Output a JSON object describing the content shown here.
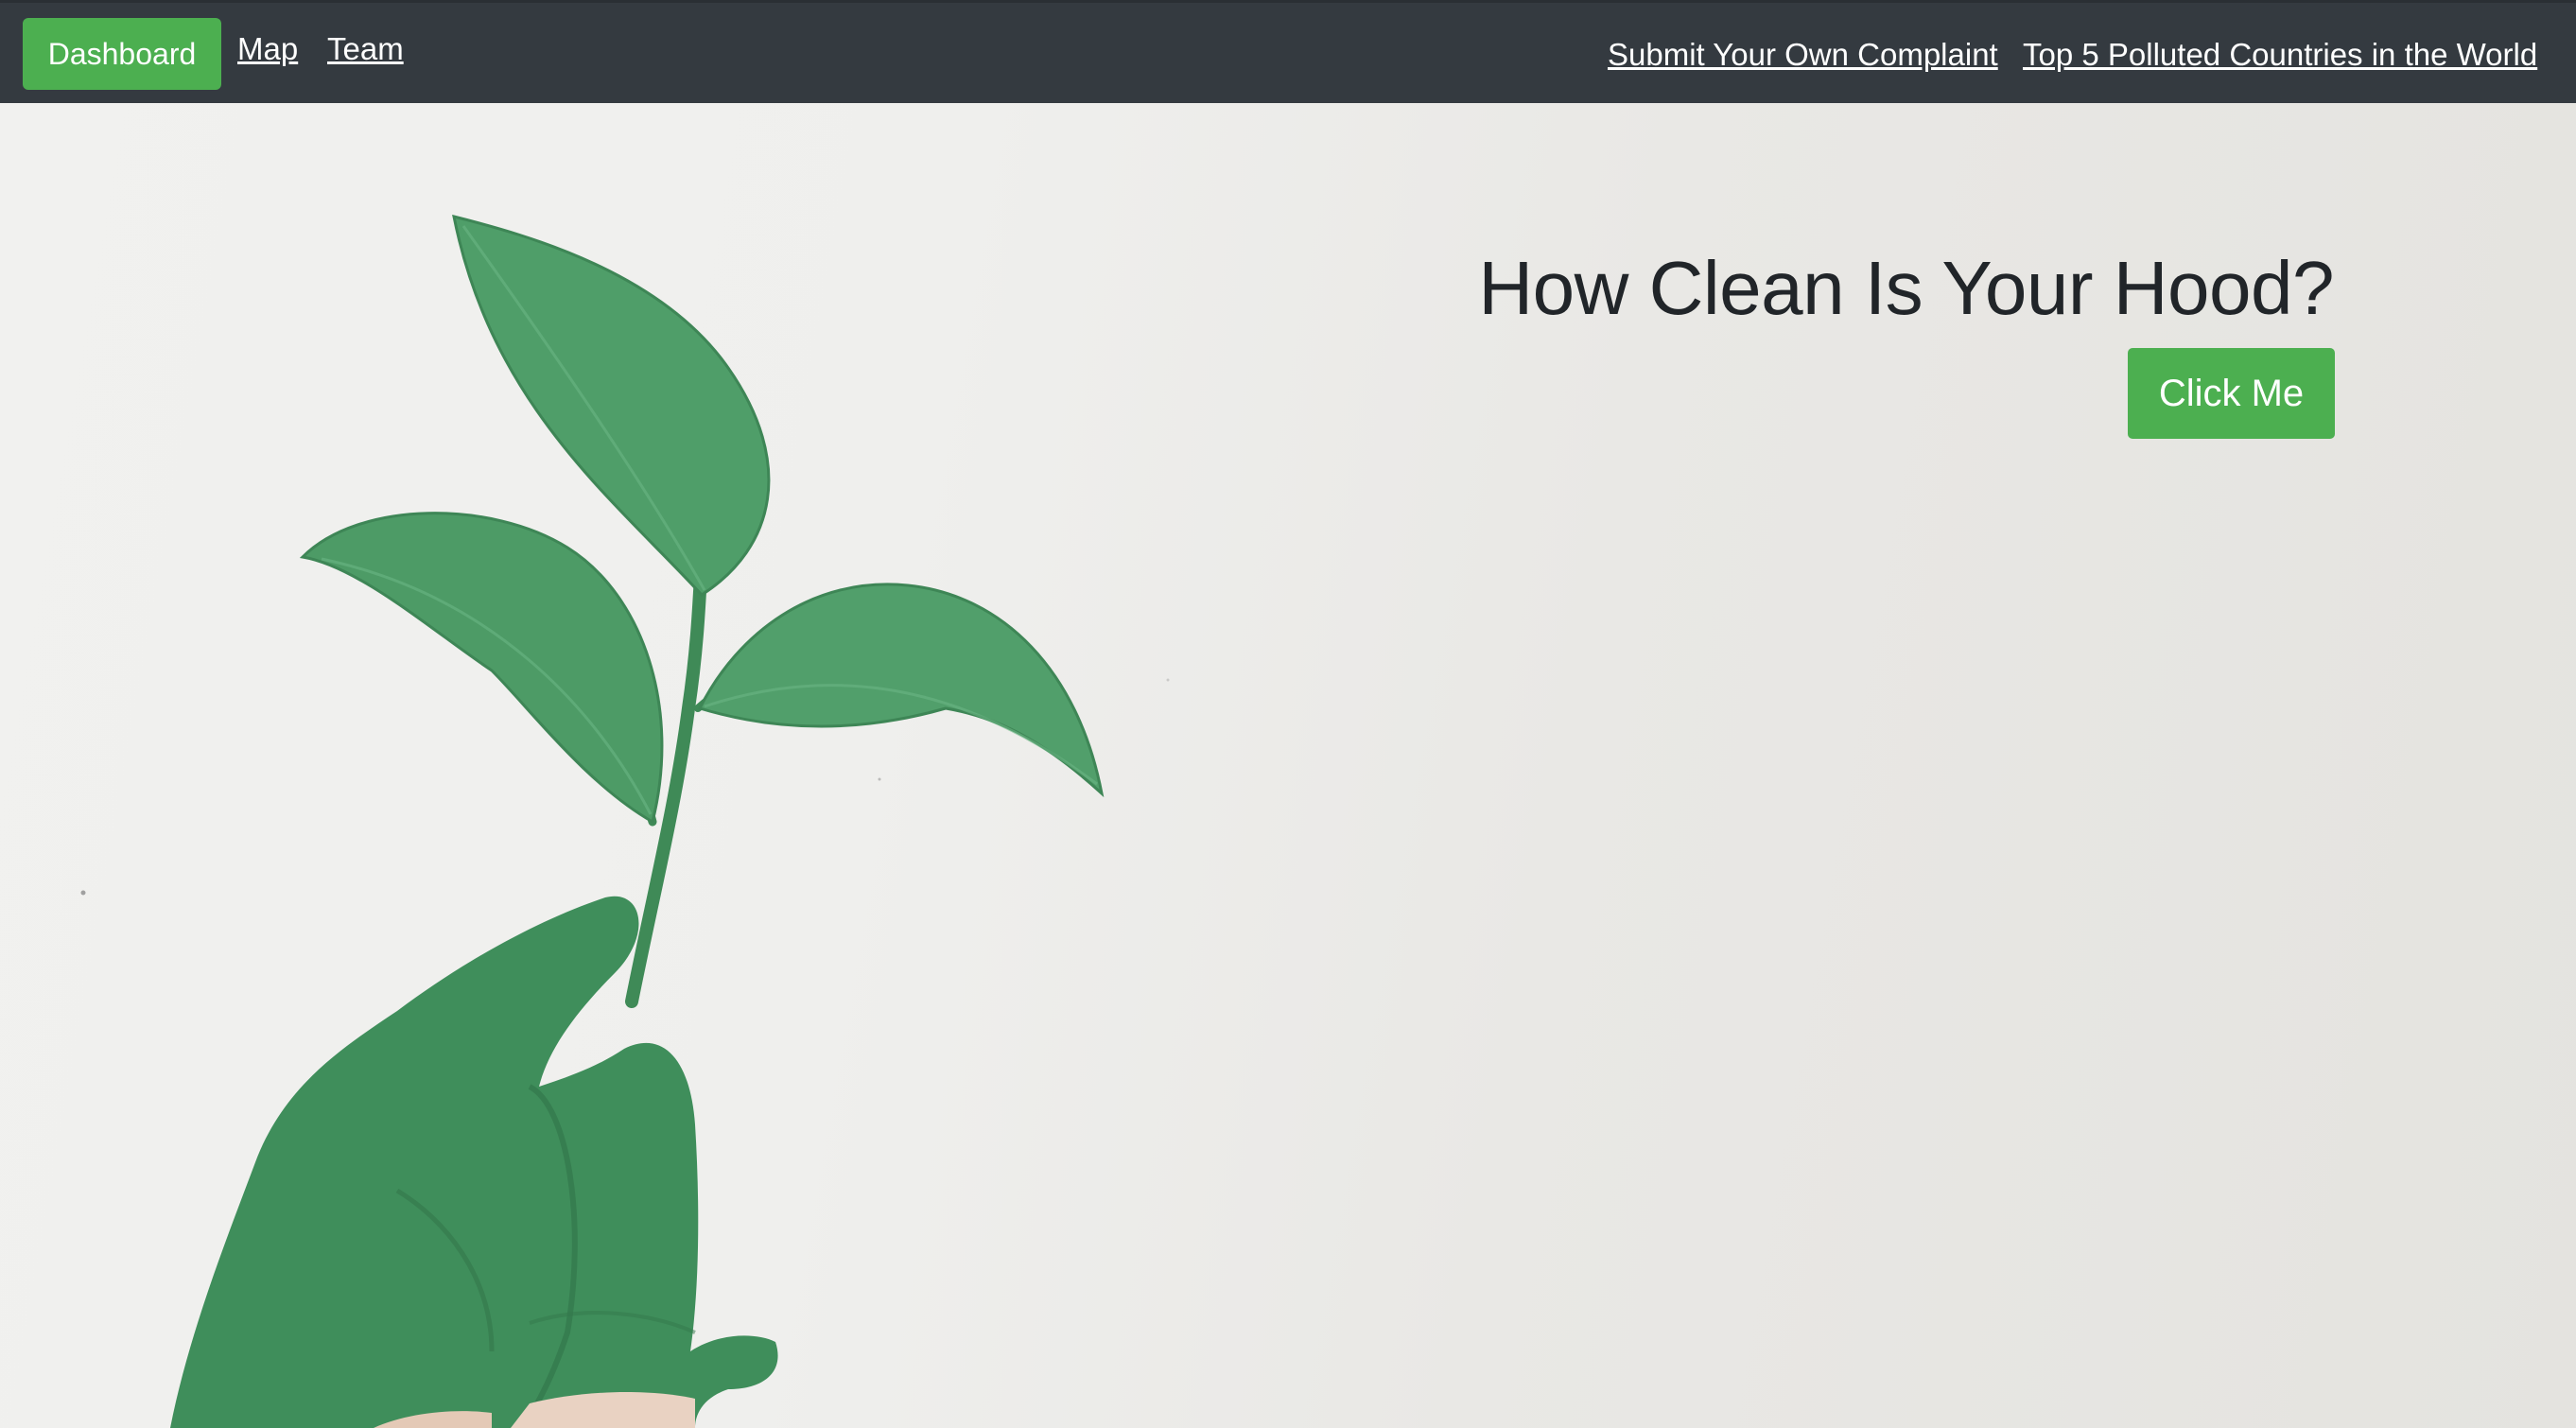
{
  "nav": {
    "left_items": [
      {
        "label": "Dashboard"
      },
      {
        "label": "Map"
      },
      {
        "label": "Team"
      }
    ],
    "right_items": [
      {
        "label": "Submit Your Own Complaint"
      },
      {
        "label": "Top 5 Polluted Countries in the World"
      }
    ]
  },
  "hero": {
    "title": "How Clean Is Your Hood?",
    "cta_label": "Click Me",
    "image_subject": "green-painted hand holding a leafy plant sprig"
  },
  "colors": {
    "navbar_bg": "#343a40",
    "accent_green": "#4caf50",
    "plant_green": "#4a9e68",
    "title_text": "#212529"
  }
}
